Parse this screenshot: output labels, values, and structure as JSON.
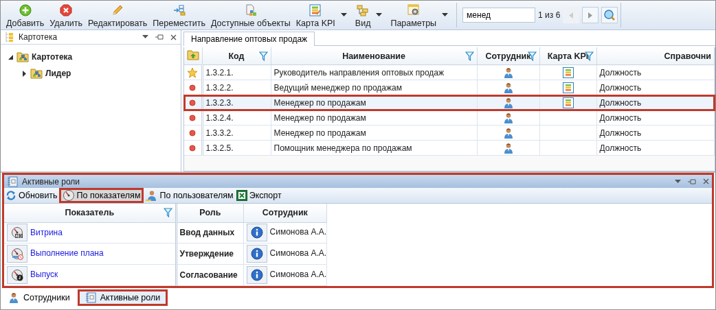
{
  "toolbar": {
    "buttons": [
      {
        "label": "Добавить",
        "dropdown": false
      },
      {
        "label": "Удалить",
        "dropdown": false
      },
      {
        "label": "Редактировать",
        "dropdown": false
      },
      {
        "label": "Переместить",
        "dropdown": false
      },
      {
        "label": "Доступные объекты",
        "dropdown": false
      },
      {
        "label": "Карта KPI",
        "dropdown": true
      },
      {
        "label": "Вид",
        "dropdown": true
      },
      {
        "label": "Параметры",
        "dropdown": true
      }
    ],
    "search": {
      "value": "менед"
    },
    "match_count": "1 из 6",
    "nav_buttons": [
      {
        "kind": "prev",
        "disabled": true
      },
      {
        "kind": "next",
        "disabled": false
      }
    ]
  },
  "left_panel": {
    "title": "Картотека",
    "tree": [
      {
        "label": "Картотека",
        "expanded": true,
        "children": [
          {
            "label": "Лидер",
            "expanded": false
          }
        ]
      }
    ]
  },
  "document_tab": {
    "label": "Направление оптовых продаж",
    "selected": true
  },
  "table": {
    "columns": [
      {
        "label": "Код",
        "filter": true
      },
      {
        "label": "Наименование",
        "filter": true
      },
      {
        "label": "Сотрудник",
        "filter": true
      },
      {
        "label": "Карта KPI",
        "filter": true
      },
      {
        "label": "Справочни",
        "filter": false
      }
    ],
    "rows": [
      {
        "kind": "star",
        "code": "1.3.2.1.",
        "name": "Руководитель направления оптовых продаж",
        "kpi_map": true,
        "directory": "Должность",
        "selected": false,
        "highlighted": false
      },
      {
        "kind": "dot",
        "code": "1.3.2.2.",
        "name": "Ведущий менеджер по продажам",
        "kpi_map": true,
        "directory": "Должность",
        "selected": false,
        "highlighted": false
      },
      {
        "kind": "dot",
        "code": "1.3.2.3.",
        "name": "Менеджер по продажам",
        "kpi_map": true,
        "directory": "Должность",
        "selected": true,
        "highlighted": true
      },
      {
        "kind": "dot",
        "code": "1.3.2.4.",
        "name": "Менеджер по продажам",
        "kpi_map": false,
        "directory": "Должность",
        "selected": false,
        "highlighted": false
      },
      {
        "kind": "dot",
        "code": "1.3.3.2.",
        "name": "Менеджер по продажам",
        "kpi_map": false,
        "directory": "Должность",
        "selected": false,
        "highlighted": false
      },
      {
        "kind": "dot",
        "code": "1.3.2.5.",
        "name": "Помощник менеджера по продажам",
        "kpi_map": false,
        "directory": "Должность",
        "selected": false,
        "highlighted": false
      }
    ]
  },
  "roles_panel": {
    "title": "Активные роли",
    "highlighted": true,
    "toolbar": [
      {
        "label": "Обновить",
        "selected": false,
        "highlighted": false
      },
      {
        "label": "По показателям",
        "selected": true,
        "highlighted": true
      },
      {
        "label": "По пользователям",
        "selected": false,
        "highlighted": false
      },
      {
        "label": "Экспорт",
        "selected": false,
        "highlighted": false
      }
    ],
    "indicators": {
      "column": {
        "label": "Показатель",
        "filter": true
      },
      "rows": [
        {
          "label": "Витрина"
        },
        {
          "label": "Выполнение плана"
        },
        {
          "label": "Выпуск"
        }
      ]
    },
    "roles": {
      "columns": [
        "Роль",
        "Сотрудник"
      ],
      "rows": [
        {
          "role": "Ввод данных",
          "employee": "Симонова А.А."
        },
        {
          "role": "Утверждение",
          "employee": "Симонова А.А."
        },
        {
          "role": "Согласование",
          "employee": "Симонова А.А."
        }
      ]
    }
  },
  "bottom_tabs": [
    {
      "label": "Сотрудники",
      "selected": false,
      "highlighted": false
    },
    {
      "label": "Активные роли",
      "selected": true,
      "highlighted": true
    }
  ]
}
